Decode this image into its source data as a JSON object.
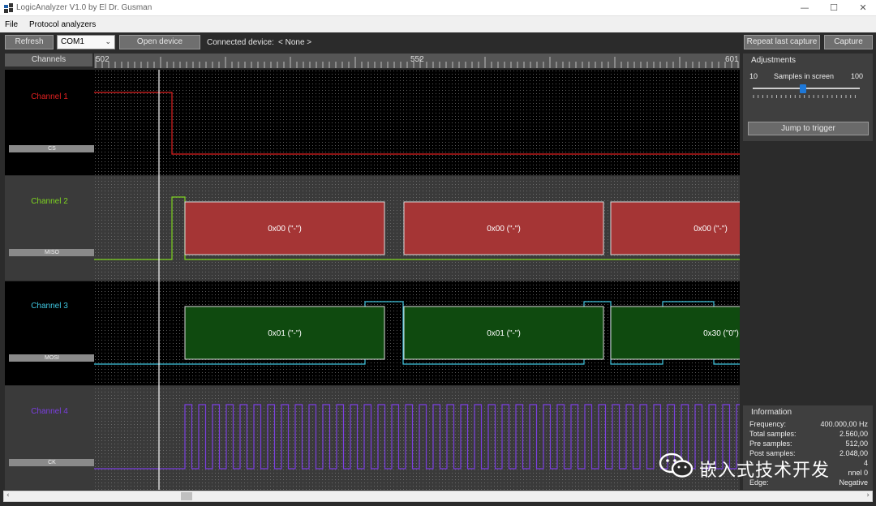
{
  "window": {
    "title": "LogicAnalyzer V1.0 by El Dr. Gusman"
  },
  "menu": [
    "File",
    "Protocol analyzers"
  ],
  "toolbar": {
    "refresh_label": "Refresh",
    "port_value": "COM1",
    "open_label": "Open device",
    "connected_label": "Connected device:",
    "connected_value": "< None >",
    "repeat_label": "Repeat last capture",
    "capture_label": "Capture"
  },
  "channels_header": "Channels",
  "ruler": {
    "labels": [
      "502",
      "552",
      "601"
    ]
  },
  "channels": [
    {
      "name": "Channel 1",
      "tag": "CS",
      "color": "#e02020"
    },
    {
      "name": "Channel 2",
      "tag": "MISO",
      "color": "#7ed321"
    },
    {
      "name": "Channel 3",
      "tag": "MOSI",
      "color": "#3fc6e0"
    },
    {
      "name": "Channel 4",
      "tag": "CK",
      "color": "#7b3fe0"
    }
  ],
  "miso_frames": [
    "0x00 (\"-\")",
    "0x00 (\"-\")",
    "0x00 (\"-\")"
  ],
  "mosi_frames": [
    "0x01 (\"-\")",
    "0x01 (\"-\")",
    "0x30 (\"0\")"
  ],
  "adjustments": {
    "title": "Adjustments",
    "min": "10",
    "label": "Samples in screen",
    "max": "100",
    "jump_label": "Jump to trigger"
  },
  "information": {
    "title": "Information",
    "rows": [
      {
        "k": "Frequency:",
        "v": "400.000,00 Hz"
      },
      {
        "k": "Total samples:",
        "v": "2.560,00"
      },
      {
        "k": "Pre samples:",
        "v": "512,00"
      },
      {
        "k": "Post samples:",
        "v": "2.048,00"
      },
      {
        "k": "",
        "v": "4"
      },
      {
        "k": "",
        "v": "nnel 0"
      },
      {
        "k": "Edge:",
        "v": "Negative"
      }
    ]
  },
  "watermark": {
    "text": "嵌入式技术开发"
  },
  "colors": {
    "miso_fill": "#a53535",
    "mosi_fill": "#0f4a0f"
  }
}
